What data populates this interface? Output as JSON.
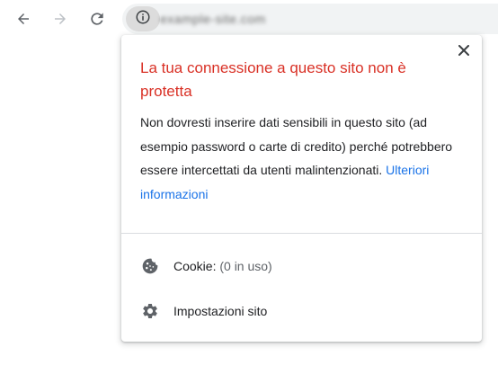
{
  "browser": {
    "back_icon": "arrow-back-icon",
    "forward_icon": "arrow-forward-icon",
    "reload_icon": "reload-icon",
    "site_info_icon": "info-icon",
    "url_blurred": "example-site.com"
  },
  "popup": {
    "title": "La tua connessione a questo sito non è protetta",
    "description": "Non dovresti inserire dati sensibili in questo sito (ad esempio password o carte di credito) perché potrebbero essere intercettati da utenti malintenzionati.",
    "link_text": "Ulteriori informazioni",
    "close_icon": "close-icon",
    "items": [
      {
        "icon": "cookie-icon",
        "label": "Cookie:",
        "detail": "(0 in uso)"
      },
      {
        "icon": "gear-icon",
        "label": "Impostazioni sito",
        "detail": ""
      }
    ]
  },
  "colors": {
    "warning_red": "#d93025",
    "link_blue": "#1a73e8",
    "omnibox_bg": "#f1f3f4",
    "chip_bg": "#dcdcdc"
  }
}
